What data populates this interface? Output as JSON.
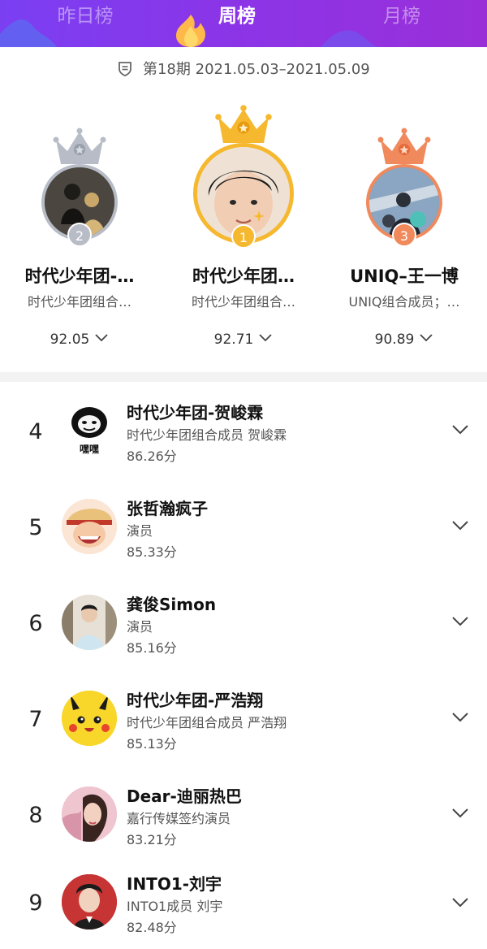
{
  "tabs": {
    "yesterday": "昨日榜",
    "weekly": "周榜",
    "monthly": "月榜",
    "active": "weekly"
  },
  "period": {
    "issue": "第18期",
    "range": "2021.05.03–2021.05.09"
  },
  "podium": [
    {
      "rank": "2",
      "name": "时代少年团-…",
      "desc": "时代少年团组合…",
      "score": "92.05",
      "medal": "silver"
    },
    {
      "rank": "1",
      "name": "时代少年团…",
      "desc": "时代少年团组合…",
      "score": "92.71",
      "medal": "gold"
    },
    {
      "rank": "3",
      "name": "UNIQ–王一博",
      "desc": "UNIQ组合成员；…",
      "score": "90.89",
      "medal": "bronze"
    }
  ],
  "list": [
    {
      "rank": "4",
      "name": "时代少年团-贺峻霖",
      "desc": "时代少年团组合成员 贺峻霖",
      "score": "86.26分",
      "avatar_text": "嘿嘿"
    },
    {
      "rank": "5",
      "name": "张哲瀚疯子",
      "desc": "演员",
      "score": "85.33分"
    },
    {
      "rank": "6",
      "name": "龚俊Simon",
      "desc": "演员",
      "score": "85.16分"
    },
    {
      "rank": "7",
      "name": "时代少年团-严浩翔",
      "desc": "时代少年团组合成员 严浩翔",
      "score": "85.13分"
    },
    {
      "rank": "8",
      "name": "Dear-迪丽热巴",
      "desc": "嘉行传媒签约演员",
      "score": "83.21分"
    },
    {
      "rank": "9",
      "name": "INTO1-刘宇",
      "desc": "INTO1成员 刘宇",
      "score": "82.48分"
    }
  ],
  "colors": {
    "header_start": "#7b3ff2",
    "header_end": "#9a2fd8",
    "gold": "#f5b82e",
    "silver": "#b7bcc6",
    "bronze": "#f08a5d"
  },
  "icons": {
    "period": "calendar-shield-icon",
    "expand": "chevron-down-icon",
    "tab_highlight": "flame-icon"
  }
}
